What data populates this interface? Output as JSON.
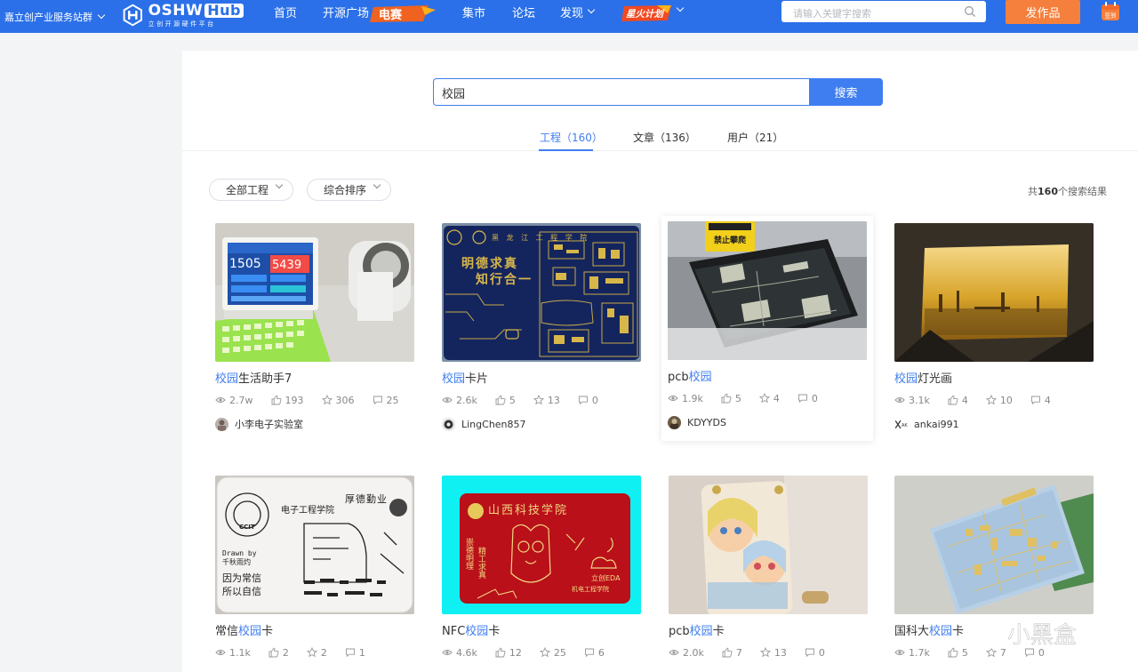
{
  "topbar": {
    "station": "嘉立创产业服务站群",
    "logo": {
      "main": "OSHW",
      "hub": "Hub",
      "sub": "立创开源硬件平台"
    },
    "nav": [
      {
        "label": "首页"
      },
      {
        "label": "开源广场"
      },
      {
        "label": "集市"
      },
      {
        "label": "论坛"
      },
      {
        "label": "发现"
      }
    ],
    "badge_dianSai": "电赛",
    "badge_xinghuo": "星火计划",
    "search_placeholder": "请输入关键字搜索",
    "publish_label": "发作品",
    "checkin_label": "签到"
  },
  "search": {
    "query": "校园",
    "button": "搜索"
  },
  "tabs": [
    {
      "label": "工程（160）",
      "active": true
    },
    {
      "label": "文章（136）",
      "active": false
    },
    {
      "label": "用户（21）",
      "active": false
    }
  ],
  "filters": {
    "category": "全部工程",
    "sort": "综合排序"
  },
  "result_count": {
    "prefix": "共",
    "count": "160",
    "suffix": "个搜索结果"
  },
  "colors": {
    "brand": "#2b70e8",
    "accent": "#3f7ef0",
    "publish": "#f5803e"
  },
  "cards": [
    {
      "title_pre": "",
      "title_hl": "校园",
      "title_post": "生活助手7",
      "views": "2.7w",
      "likes": "193",
      "stars": "306",
      "comments": "25",
      "author": "小李电子实验室"
    },
    {
      "title_pre": "",
      "title_hl": "校园",
      "title_post": "卡片",
      "views": "2.6k",
      "likes": "5",
      "stars": "13",
      "comments": "0",
      "author": "LingChen857"
    },
    {
      "title_pre": "pcb",
      "title_hl": "校园",
      "title_post": "",
      "views": "1.9k",
      "likes": "5",
      "stars": "4",
      "comments": "0",
      "author": "KDYYDS"
    },
    {
      "title_pre": "",
      "title_hl": "校园",
      "title_post": "灯光画",
      "views": "3.1k",
      "likes": "4",
      "stars": "10",
      "comments": "4",
      "author": "ankai991"
    },
    {
      "title_pre": "常信",
      "title_hl": "校园",
      "title_post": "卡",
      "views": "1.1k",
      "likes": "2",
      "stars": "2",
      "comments": "1",
      "author": ""
    },
    {
      "title_pre": "NFC",
      "title_hl": "校园",
      "title_post": "卡",
      "views": "4.6k",
      "likes": "12",
      "stars": "25",
      "comments": "6",
      "author": ""
    },
    {
      "title_pre": "pcb",
      "title_hl": "校园",
      "title_post": "卡",
      "views": "2.0k",
      "likes": "7",
      "stars": "13",
      "comments": "0",
      "author": ""
    },
    {
      "title_pre": "国科大",
      "title_hl": "校园",
      "title_post": "卡",
      "views": "1.7k",
      "likes": "5",
      "stars": "7",
      "comments": "0",
      "author": ""
    }
  ],
  "thumb_texts": {
    "card1_left": "1505",
    "card1_right": "5439",
    "card2_motto1": "明德求真",
    "card2_motto2": "知行合一",
    "card3_sign": "禁止攀爬",
    "card5_dept": "电子工程学院",
    "card5_motto": "厚德勤业",
    "card5_drawn": "Drawn by",
    "card5_drawn_name": "千秋雨灼",
    "card5_line1": "因为常信",
    "card5_line2": "所以自信",
    "card6_school": "山西科技学院",
    "card6_v1": "崇德明理",
    "card6_v2": "精工求真",
    "card6_eda": "立创EDA",
    "card6_dept": "机电工程学院"
  },
  "watermark": "小黑盒"
}
